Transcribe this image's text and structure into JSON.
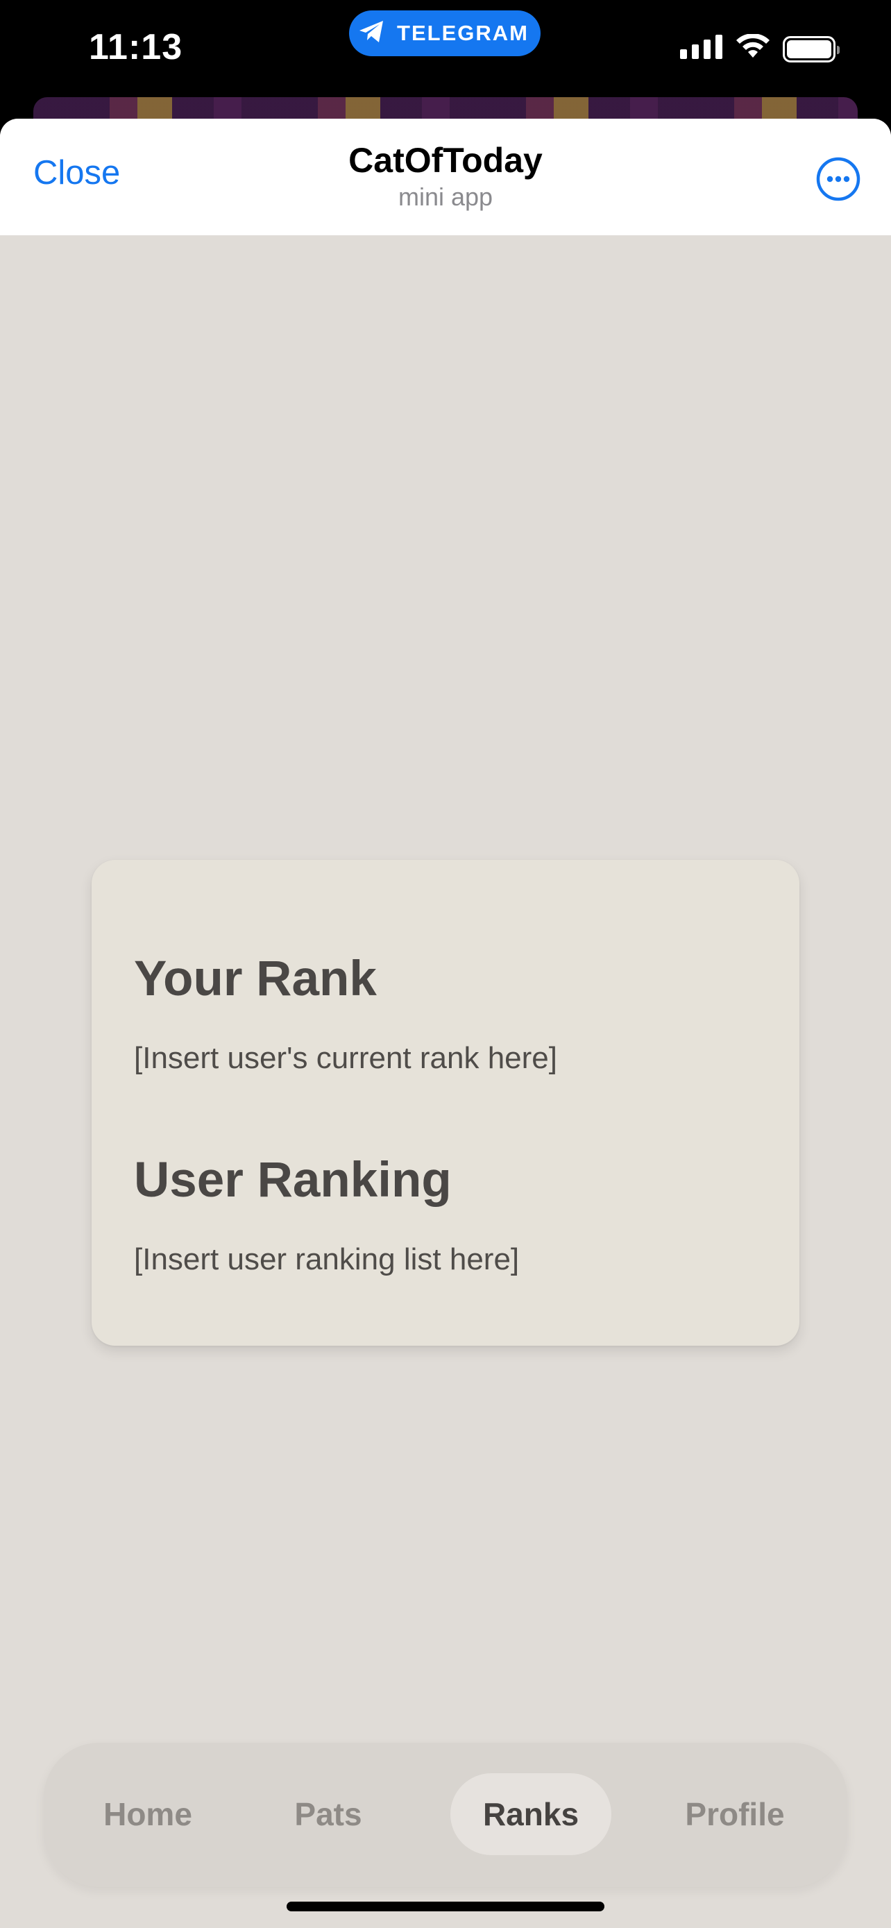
{
  "status_bar": {
    "time": "11:13",
    "pill_label": "TELEGRAM"
  },
  "header": {
    "close_label": "Close",
    "title": "CatOfToday",
    "subtitle": "mini app"
  },
  "card": {
    "rank_heading": "Your Rank",
    "rank_text": "[Insert user's current rank here]",
    "ranking_heading": "User Ranking",
    "ranking_text": "[Insert user ranking list here]"
  },
  "nav": {
    "items": [
      {
        "label": "Home",
        "active": false
      },
      {
        "label": "Pats",
        "active": false
      },
      {
        "label": "Ranks",
        "active": true
      },
      {
        "label": "Profile",
        "active": false
      }
    ]
  },
  "icons": {
    "telegram": "telegram-plane-icon",
    "signal": "cellular-signal-icon",
    "wifi": "wifi-icon",
    "battery": "battery-icon",
    "more": "more-horizontal-circle-icon"
  },
  "colors": {
    "accent": "#1577f0",
    "sheet_background": "#e0dcd7",
    "card_background": "#e6e2d9",
    "nav_background": "#d8d4cf",
    "nav_active_background": "#e6e2de",
    "text_primary": "#4a4745",
    "nav_inactive_text": "#8e8a86"
  }
}
